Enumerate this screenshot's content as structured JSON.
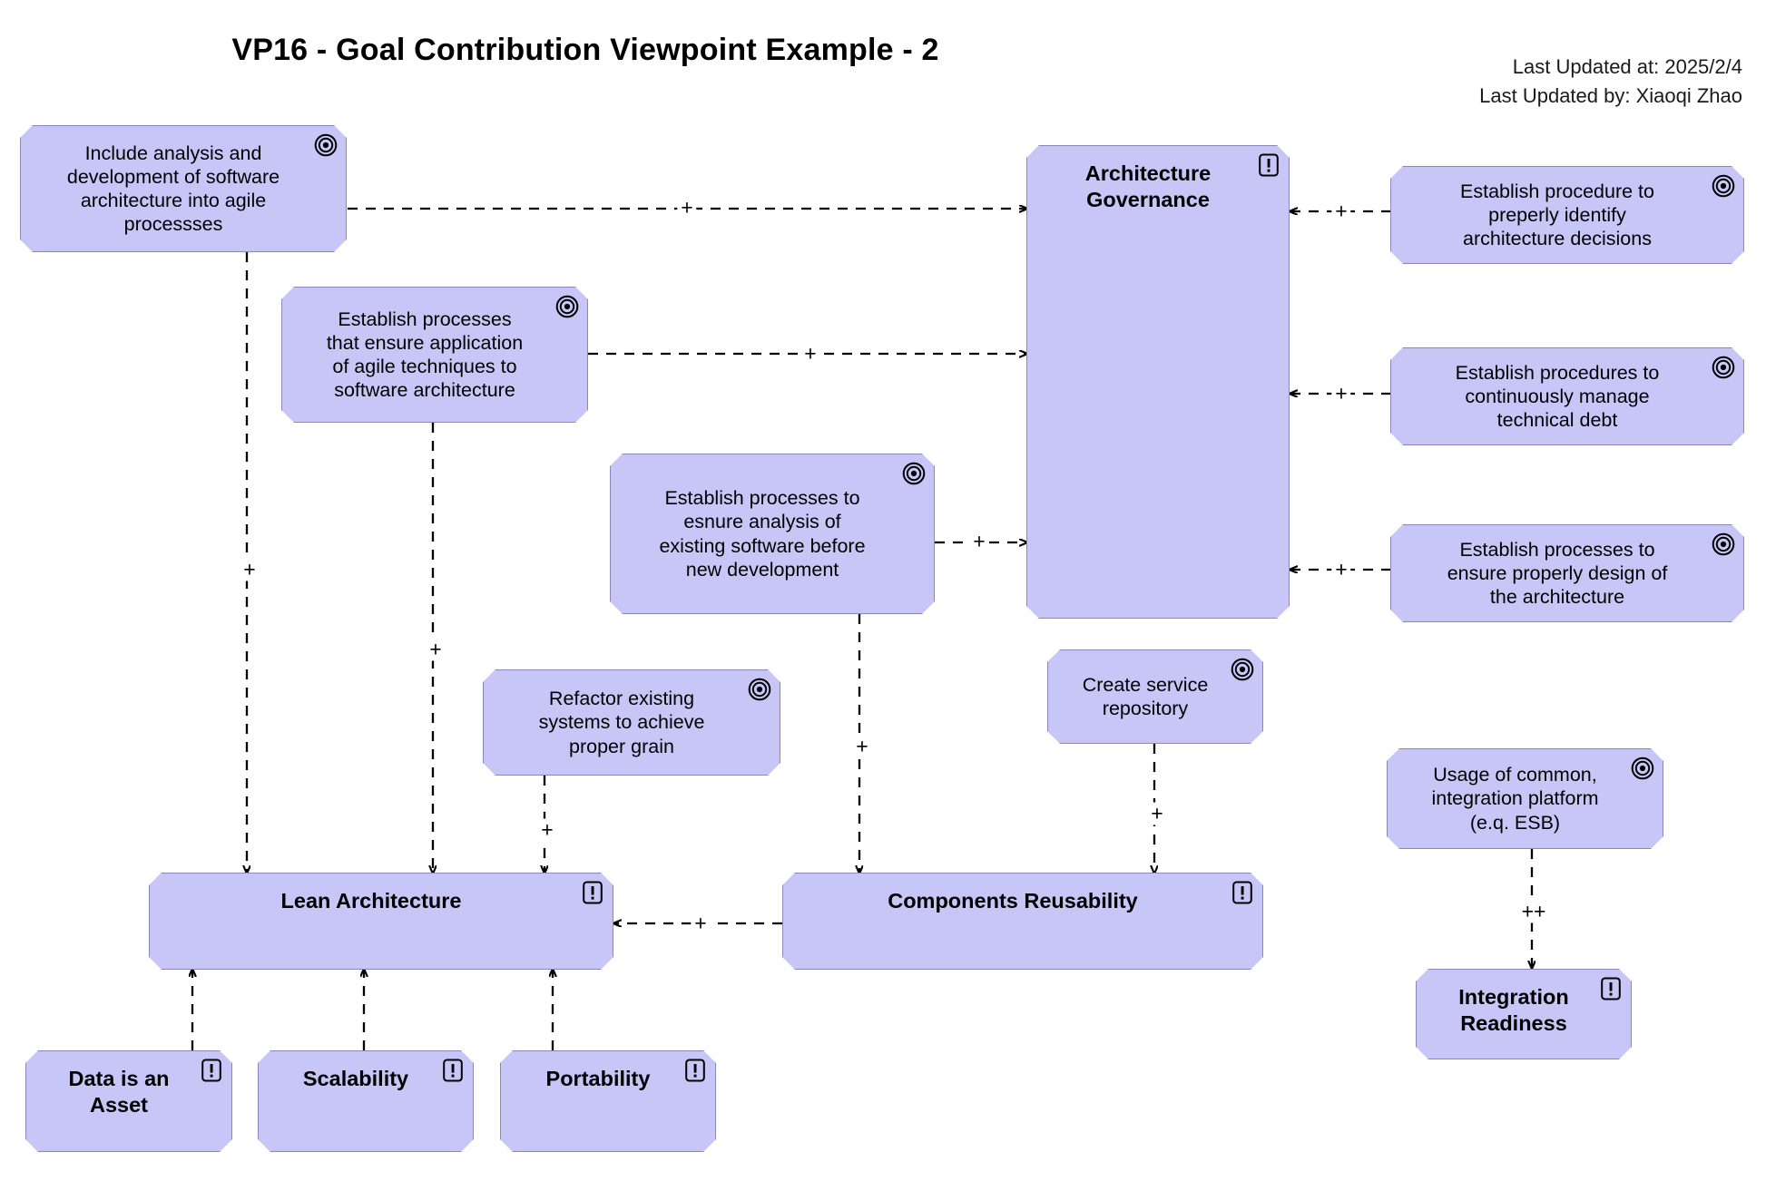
{
  "header": {
    "title": "VP16 - Goal Contribution Viewpoint Example - 2",
    "last_updated_at": "Last Updated at: 2025/2/4",
    "last_updated_by": "Last Updated by: Xiaoqi Zhao"
  },
  "icons": {
    "goal": "goal-icon",
    "principle": "principle-icon"
  },
  "nodes": [
    {
      "id": "include-analysis",
      "label": "Include analysis and\ndevelopment of software\narchitecture into agile\nprocessses",
      "type": "goal"
    },
    {
      "id": "establish-agile-processes",
      "label": "Establish processes\nthat ensure application\nof agile techniques to\nsoftware architecture",
      "type": "goal"
    },
    {
      "id": "establish-analysis-existing",
      "label": "Establish processes to\nesnure analysis of\nexisting software before\nnew development",
      "type": "goal"
    },
    {
      "id": "refactor-existing",
      "label": "Refactor existing\nsystems to achieve\nproper grain",
      "type": "goal"
    },
    {
      "id": "create-service-repository",
      "label": "Create service\nrepository",
      "type": "goal"
    },
    {
      "id": "architecture-governance",
      "label": "Architecture\nGovernance",
      "type": "principle"
    },
    {
      "id": "establish-identify-decisions",
      "label": "Establish procedure to\npreperly identify\narchitecture decisions",
      "type": "goal"
    },
    {
      "id": "manage-technical-debt",
      "label": "Establish procedures to\ncontinuously manage\ntechnical debt",
      "type": "goal"
    },
    {
      "id": "ensure-proper-design",
      "label": "Establish processes to\nensure properly design of\nthe architecture",
      "type": "goal"
    },
    {
      "id": "usage-common-platform",
      "label": "Usage of common,\nintegration platform\n(e.q. ESB)",
      "type": "goal"
    },
    {
      "id": "lean-architecture",
      "label": "Lean Architecture",
      "type": "principle"
    },
    {
      "id": "components-reusability",
      "label": "Components Reusability",
      "type": "principle"
    },
    {
      "id": "integration-readiness",
      "label": "Integration\nReadiness",
      "type": "principle"
    },
    {
      "id": "data-is-an-asset",
      "label": "Data is an\nAsset",
      "type": "principle"
    },
    {
      "id": "scalability",
      "label": "Scalability",
      "type": "principle"
    },
    {
      "id": "portability",
      "label": "Portability",
      "type": "principle"
    }
  ],
  "connections": [
    {
      "id": "c1",
      "from": "include-analysis",
      "to": "architecture-governance",
      "label": "+"
    },
    {
      "id": "c2",
      "from": "establish-agile-processes",
      "to": "architecture-governance",
      "label": "+"
    },
    {
      "id": "c3",
      "from": "establish-analysis-existing",
      "to": "architecture-governance",
      "label": "+"
    },
    {
      "id": "c4",
      "from": "establish-identify-decisions",
      "to": "architecture-governance",
      "label": "+"
    },
    {
      "id": "c5",
      "from": "manage-technical-debt",
      "to": "architecture-governance",
      "label": "+"
    },
    {
      "id": "c6",
      "from": "ensure-proper-design",
      "to": "architecture-governance",
      "label": "+"
    },
    {
      "id": "c7",
      "from": "include-analysis",
      "to": "lean-architecture",
      "label": "+"
    },
    {
      "id": "c8",
      "from": "establish-agile-processes",
      "to": "lean-architecture",
      "label": "+"
    },
    {
      "id": "c9",
      "from": "refactor-existing",
      "to": "lean-architecture",
      "label": "+"
    },
    {
      "id": "c10",
      "from": "establish-analysis-existing",
      "to": "components-reusability",
      "label": "+"
    },
    {
      "id": "c11",
      "from": "create-service-repository",
      "to": "components-reusability",
      "label": "+"
    },
    {
      "id": "c12",
      "from": "components-reusability",
      "to": "lean-architecture",
      "label": "+"
    },
    {
      "id": "c13",
      "from": "usage-common-platform",
      "to": "integration-readiness",
      "label": "++"
    },
    {
      "id": "c14",
      "from": "data-is-an-asset",
      "to": "lean-architecture",
      "label": ""
    },
    {
      "id": "c15",
      "from": "scalability",
      "to": "lean-architecture",
      "label": ""
    },
    {
      "id": "c16",
      "from": "portability",
      "to": "lean-architecture",
      "label": ""
    }
  ],
  "colors": {
    "node_fill": "#c8c6f7",
    "node_border": "#8a88b8",
    "connector": "#000000",
    "background": "#ffffff"
  }
}
